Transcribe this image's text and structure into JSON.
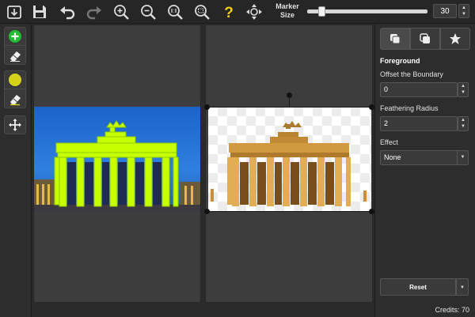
{
  "toolbar": {
    "buttons": [
      "open-icon",
      "save-icon",
      "undo-icon",
      "redo-icon",
      "zoom-in-icon",
      "zoom-out-icon",
      "actual-size-icon",
      "fit-to-screen-icon",
      "help-icon",
      "pan-view-icon"
    ],
    "marker_label_line1": "Marker",
    "marker_label_line2": "Size",
    "marker_size": "30",
    "marker_size_fraction": 0.1
  },
  "tools": [
    "keep-marker-icon",
    "keep-eraser-icon",
    "hair-marker-icon",
    "hair-eraser-icon",
    "move-icon"
  ],
  "panel": {
    "tabs": [
      "foreground-icon",
      "background-icon",
      "effects-icon"
    ],
    "section_title": "Foreground",
    "offset_label": "Offset the Boundary",
    "offset_value": "0",
    "feather_label": "Feathering Radius",
    "feather_value": "2",
    "effect_label": "Effect",
    "effect_value": "None",
    "reset_label": "Reset",
    "credits": "Credits: 70"
  },
  "colors": {
    "marker_green": "#c8ff00",
    "add_green": "#22bb33",
    "hair_yellow": "#d6d21a",
    "help_yellow": "#f2cf16"
  }
}
